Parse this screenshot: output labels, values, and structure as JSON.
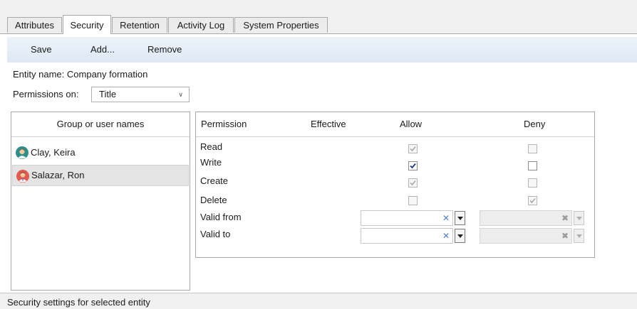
{
  "tabs": [
    {
      "label": "Attributes",
      "active": false
    },
    {
      "label": "Security",
      "active": true
    },
    {
      "label": "Retention",
      "active": false
    },
    {
      "label": "Activity Log",
      "active": false
    },
    {
      "label": "System Properties",
      "active": false
    }
  ],
  "toolbar": {
    "save_label": "Save",
    "add_label": "Add...",
    "remove_label": "Remove"
  },
  "entity": {
    "name_label": "Entity name:",
    "name_value": "Company formation",
    "permissions_on_label": "Permissions on:",
    "permissions_on_value": "Title"
  },
  "groups": {
    "header": "Group or user names",
    "users": [
      {
        "name": "Clay, Keira",
        "avatar": "female-user-icon",
        "selected": false
      },
      {
        "name": "Salazar, Ron",
        "avatar": "doctor-user-icon",
        "selected": true
      }
    ]
  },
  "permissions": {
    "headers": {
      "permission": "Permission",
      "effective": "Effective",
      "allow": "Allow",
      "deny": "Deny"
    },
    "rows": [
      {
        "label": "Read",
        "allow": true,
        "allow_enabled": false,
        "deny": false,
        "deny_enabled": false
      },
      {
        "label": "Write",
        "allow": true,
        "allow_enabled": true,
        "deny": false,
        "deny_enabled": true
      },
      {
        "label": "Create",
        "allow": true,
        "allow_enabled": false,
        "deny": false,
        "deny_enabled": false
      },
      {
        "label": "Delete",
        "allow": false,
        "allow_enabled": false,
        "deny": true,
        "deny_enabled": false
      }
    ],
    "valid_from_label": "Valid from",
    "valid_to_label": "Valid to",
    "valid_from_allow": "",
    "valid_to_allow": "",
    "valid_from_deny": "",
    "valid_to_deny": ""
  },
  "status": {
    "text": "Security settings for selected entity"
  },
  "colors": {
    "toolbar_top": "#eef3fa",
    "toolbar_bottom": "#dde8f5",
    "selection": "#e4e4e4",
    "check_active": "#1a3a7a",
    "check_disabled": "#a9a9a9"
  }
}
